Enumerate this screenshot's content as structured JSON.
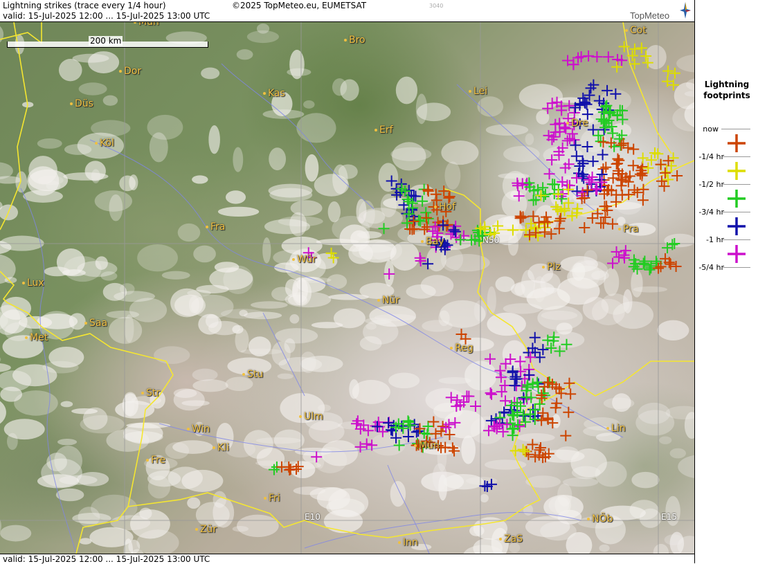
{
  "header": {
    "title": "Lightning strikes (trace every 1/4 hour)",
    "copyright": "©2025 TopMeteo.eu, EUMETSAT",
    "code": "3040",
    "valid": "valid:  15-Jul-2025 12:00 ... 15-Jul-2025 13:00 UTC",
    "logo": "TopMeteo"
  },
  "footer": {
    "valid": "valid:  15-Jul-2025 12:00 ... 15-Jul-2025 13:00 UTC"
  },
  "scale": {
    "label": "200 km"
  },
  "grid": {
    "lat_label": "N50",
    "lon_label_1": "E10",
    "lon_label_2": "E15"
  },
  "cities": [
    "Mün",
    "Bro",
    "Dor",
    "Kas",
    "Lei",
    "Düs",
    "Cot",
    "Köl",
    "Erf",
    "Dre",
    "Hof",
    "Fra",
    "Bay",
    "N50",
    "Pra",
    "Wür",
    "Plz",
    "Lux",
    "Nür",
    "Saa",
    "Met",
    "Reg",
    "Stu",
    "Str",
    "Ulm",
    "Win",
    "Kli",
    "Lin",
    "Mün",
    "Fre",
    "Fri",
    "Zür",
    "Inn",
    "NÖb",
    "ZaS"
  ],
  "legend": {
    "title_line1": "Lightning",
    "title_line2": "footprints",
    "items": [
      {
        "label": "now",
        "color": ""
      },
      {
        "label": "-1/4 hr",
        "color": "#cc4400"
      },
      {
        "label": "-1/2 hr",
        "color": "#dddd00"
      },
      {
        "label": "-3/4 hr",
        "color": "#22cc22"
      },
      {
        "label": "-1 hr",
        "color": "#1111aa"
      },
      {
        "label": "-5/4 hr",
        "color": "#cc11cc"
      }
    ]
  },
  "colors": {
    "age1": "#cc4400",
    "age2": "#dddd00",
    "age3": "#22cc22",
    "age4": "#1111aa",
    "age5": "#cc11cc",
    "city": "#f0c040"
  }
}
